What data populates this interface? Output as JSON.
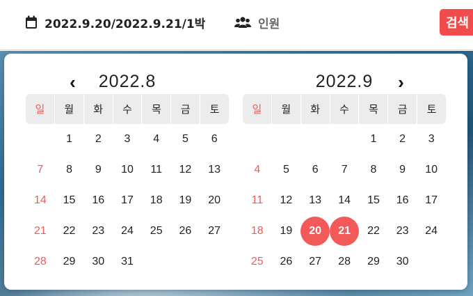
{
  "search": {
    "date_range": "2022.9.20/2022.9.21/1박",
    "guests_label": "인원",
    "search_button": "검색"
  },
  "icons": {
    "date": "calendar-icon",
    "guests": "users-icon",
    "prev": "chevron-left-icon",
    "next": "chevron-right-icon"
  },
  "colors": {
    "accent": "#f24b4b",
    "sunday": "#f05a5a",
    "weekday_bg": "#ececec"
  },
  "calendar": {
    "weekday_names": [
      "일",
      "월",
      "화",
      "수",
      "목",
      "금",
      "토"
    ],
    "months": [
      {
        "title": "2022.8",
        "weeks": [
          [
            "",
            "1",
            "2",
            "3",
            "4",
            "5",
            "6"
          ],
          [
            "7",
            "8",
            "9",
            "10",
            "11",
            "12",
            "13"
          ],
          [
            "14",
            "15",
            "16",
            "17",
            "18",
            "19",
            "20"
          ],
          [
            "21",
            "22",
            "23",
            "24",
            "25",
            "26",
            "27"
          ],
          [
            "28",
            "29",
            "30",
            "31",
            "",
            "",
            ""
          ]
        ]
      },
      {
        "title": "2022.9",
        "weeks": [
          [
            "",
            "",
            "",
            "",
            "1",
            "2",
            "3"
          ],
          [
            "4",
            "5",
            "6",
            "7",
            "8",
            "9",
            "10"
          ],
          [
            "11",
            "12",
            "13",
            "14",
            "15",
            "16",
            "17"
          ],
          [
            "18",
            "19",
            "20",
            "21",
            "22",
            "23",
            "24"
          ],
          [
            "25",
            "26",
            "27",
            "28",
            "29",
            "30",
            ""
          ]
        ],
        "selected": [
          "20",
          "21"
        ]
      }
    ]
  }
}
